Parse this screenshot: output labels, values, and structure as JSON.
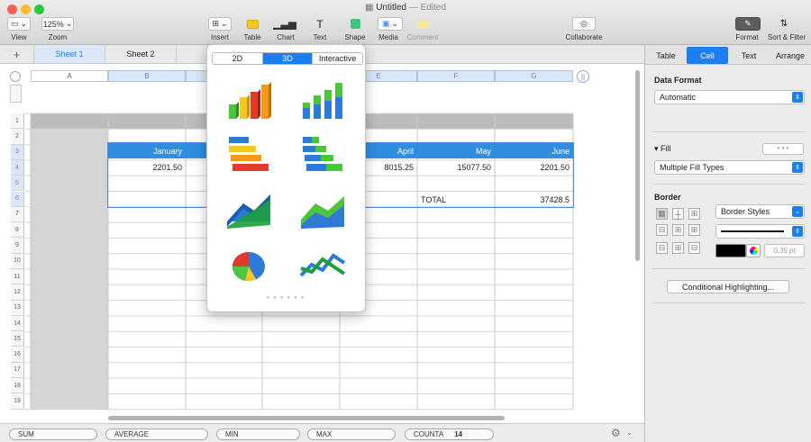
{
  "window": {
    "title": "Untitled",
    "edited": "— Edited"
  },
  "toolbar": {
    "view_label": "View",
    "zoom_value": "125%",
    "zoom_label": "Zoom",
    "insert_label": "Insert",
    "table_label": "Table",
    "chart_label": "Chart",
    "text_label": "Text",
    "shape_label": "Shape",
    "media_label": "Media",
    "comment_label": "Comment",
    "collaborate_label": "Collaborate",
    "format_label": "Format",
    "sort_label": "Sort & Filter"
  },
  "sheets": {
    "add": "+",
    "tabs": [
      "Sheet 1",
      "Sheet 2"
    ]
  },
  "columns": [
    "A",
    "B",
    "C",
    "D",
    "E",
    "F",
    "G"
  ],
  "rows": [
    "1",
    "2",
    "3",
    "4",
    "5",
    "6",
    "7",
    "8",
    "9",
    "10",
    "11",
    "12",
    "13",
    "14",
    "15",
    "16",
    "17",
    "18",
    "19"
  ],
  "table": {
    "months": [
      "January",
      "April",
      "May",
      "June"
    ],
    "values": [
      "2201.50",
      "8015.25",
      "15077.50",
      "2201.50"
    ],
    "total_label": "TOTAL",
    "total_value": "37428.5"
  },
  "chart_popover": {
    "segments": [
      "2D",
      "3D",
      "Interactive"
    ],
    "selected": "3D",
    "options": [
      "3d-column-chart-icon",
      "3d-stacked-column-chart-icon",
      "3d-bar-chart-icon",
      "3d-stacked-bar-chart-icon",
      "3d-area-chart-icon",
      "3d-stacked-area-chart-icon",
      "3d-pie-chart-icon",
      "3d-line-chart-icon"
    ]
  },
  "panel": {
    "tabs": [
      "Table",
      "Cell",
      "Text",
      "Arrange"
    ],
    "selected_tab": "Cell",
    "data_format_label": "Data Format",
    "data_format_value": "Automatic",
    "fill_label": "Fill",
    "fill_value": "Multiple Fill Types",
    "border_label": "Border",
    "border_styles": "Border Styles",
    "border_width": "0.35 pt",
    "conditional": "Conditional Highlighting..."
  },
  "status": {
    "sum": "SUM",
    "average": "AVERAGE",
    "min": "MIN",
    "max": "MAX",
    "counta": "COUNTA",
    "counta_value": "14"
  },
  "colors": {
    "accent": "#1d7ef2",
    "table_header": "#2f8ee0",
    "green": "#4cc43c",
    "yellow": "#f5c724"
  }
}
